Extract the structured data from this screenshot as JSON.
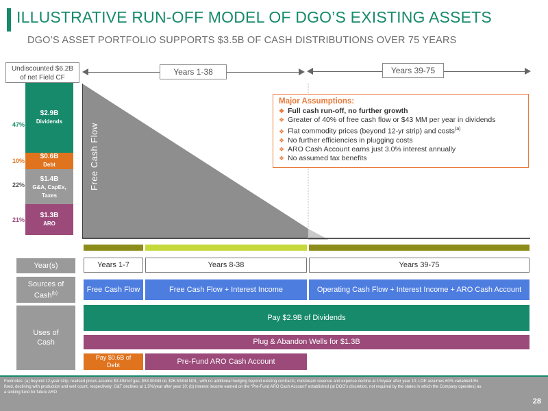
{
  "header": {
    "title": "ILLUSTRATIVE RUN-OFF MODEL OF DGO’S EXISTING ASSETS",
    "subtitle": "DGO’S ASSET PORTFOLIO SUPPORTS $3.5B OF CASH DISTRIBUTIONS OVER 75 YEARS"
  },
  "undiscounted": {
    "line1": "Undiscounted $6.2B",
    "line2": "of net Field CF"
  },
  "stack": [
    {
      "pct": "47%",
      "value": "$2.9B",
      "label": "Dividends",
      "color": "#178a6b",
      "pct_color": "#178a6b"
    },
    {
      "pct": "10%",
      "value": "$0.6B",
      "label": "Debt",
      "color": "#e0731e",
      "pct_color": "#e0731e"
    },
    {
      "pct": "22%",
      "value": "$1.4B",
      "label": "G&A, CapEx, Taxes",
      "color": "#9a9a9a",
      "pct_color": "#555555"
    },
    {
      "pct": "21%",
      "value": "$1.3B",
      "label": "ARO",
      "color": "#9b4a7a",
      "pct_color": "#9b4a7a"
    }
  ],
  "periods": {
    "early": "Years 1-38",
    "late": "Years 39-75"
  },
  "chart": {
    "ylabel": "Free Cash Flow"
  },
  "assumptions": {
    "heading": "Major Assumptions:",
    "items": [
      {
        "text": "Full cash run-off, no further growth",
        "bold": true
      },
      {
        "text": "Greater of 40% of free cash flow or $43 MM per year in dividends",
        "bold": false
      },
      {
        "text": "Flat commodity prices (beyond 12-yr strip) and costs",
        "sup": "(a)",
        "bold": false
      },
      {
        "text": "No further efficiencies in plugging costs",
        "bold": false
      },
      {
        "text": "ARO Cash Account earns just 3.0% interest annually",
        "bold": false
      },
      {
        "text": "No assumed tax benefits",
        "bold": false
      }
    ]
  },
  "table": {
    "row_years_label": "Year(s)",
    "row_sources_label": "Sources of Cash",
    "row_sources_sup": "(b)",
    "row_uses_label_1": "Uses of",
    "row_uses_label_2": "Cash",
    "years": [
      "Years 1-7",
      "Years 8-38",
      "Years 39-75"
    ],
    "sources": [
      "Free Cash Flow",
      "Free Cash Flow + Interest Income",
      "Operating Cash Flow + Interest Income + ARO Cash Account"
    ],
    "uses": {
      "dividends": "Pay  $2.9B of Dividends",
      "plug": "Plug & Abandon Wells for $1.3B",
      "debt_1": "Pay $0.6B of",
      "debt_2": "Debt",
      "prefund": "Pre-Fund ARO Cash Account"
    }
  },
  "colors": {
    "brand": "#178a6b",
    "source_blue": "#4e7de0",
    "aro_purple": "#9b4a7a",
    "debt_orange": "#e0731e",
    "assump_orange": "#e97a3b",
    "olive": "#8c8c1a",
    "lime": "#c5d93a"
  },
  "footnote": "Footnotes: (a) beyond 12-year strip, realised prices assume $3.49/mcf gas, $53.00/bbl oil, $26.50/bbl NGL, with no additional hedging beyond existing contracts; midstream revenue and expense decline at 1%/year after year 10; LOE assumes 60% variable/40% fixed, declining with production and well count, respectively; G&T declines at 1.5%/year after year 10; (b) interest income earned on the “Pre-Fund ARO Cash Account” established (at DGO’s discretion, not required by the states in which the Company operates) as a sinking fund for future ARO",
  "page_number": "28"
}
